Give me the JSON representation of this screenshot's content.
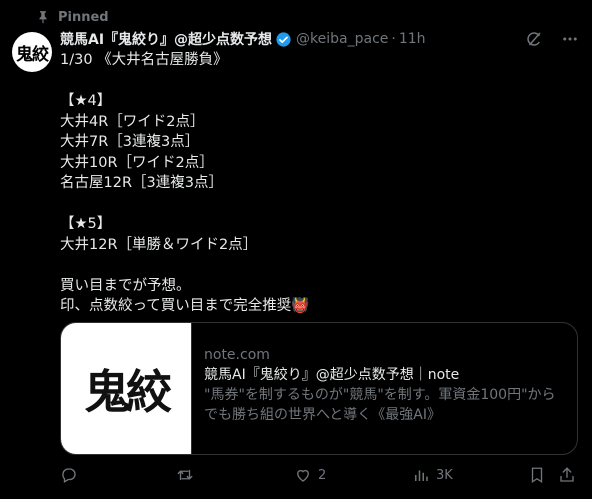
{
  "pinned_label": "Pinned",
  "author": {
    "avatar_text": "鬼絞",
    "display_name": "競馬AI『鬼絞り』@超少点数予想",
    "handle": "@keiba_pace",
    "time": "11h"
  },
  "tweet_lines": [
    "1/30 《大井名古屋勝負》",
    "",
    "【★4】",
    "大井4R［ワイド2点］",
    "大井7R［3連複3点］",
    "大井10R［ワイド2点］",
    "名古屋12R［3連複3点］",
    "",
    "【★5】",
    "大井12R［単勝＆ワイド2点］",
    "",
    "買い目までが予想。",
    "印、点数絞って買い目まで完全推奨👹"
  ],
  "card": {
    "thumb_text": "鬼絞",
    "domain": "note.com",
    "title": "競馬AI『鬼絞り』@超少点数予想｜note",
    "description": "\"馬券\"を制するものが\"競馬\"を制す。軍資金100円\"からでも勝ち組の世界へと導く《最強AI》"
  },
  "actions": {
    "replies": "",
    "retweets": "",
    "likes": "2",
    "views": "3K"
  },
  "colors": {
    "background": "#000000",
    "text": "#e7e9ea",
    "muted": "#71767b",
    "border": "#2f3336",
    "verified": "#1d9bf0"
  },
  "icons": [
    "pin-icon",
    "verified-badge-icon",
    "grok-icon",
    "more-icon",
    "reply-icon",
    "retweet-icon",
    "like-icon",
    "views-icon",
    "bookmark-icon",
    "share-icon"
  ]
}
